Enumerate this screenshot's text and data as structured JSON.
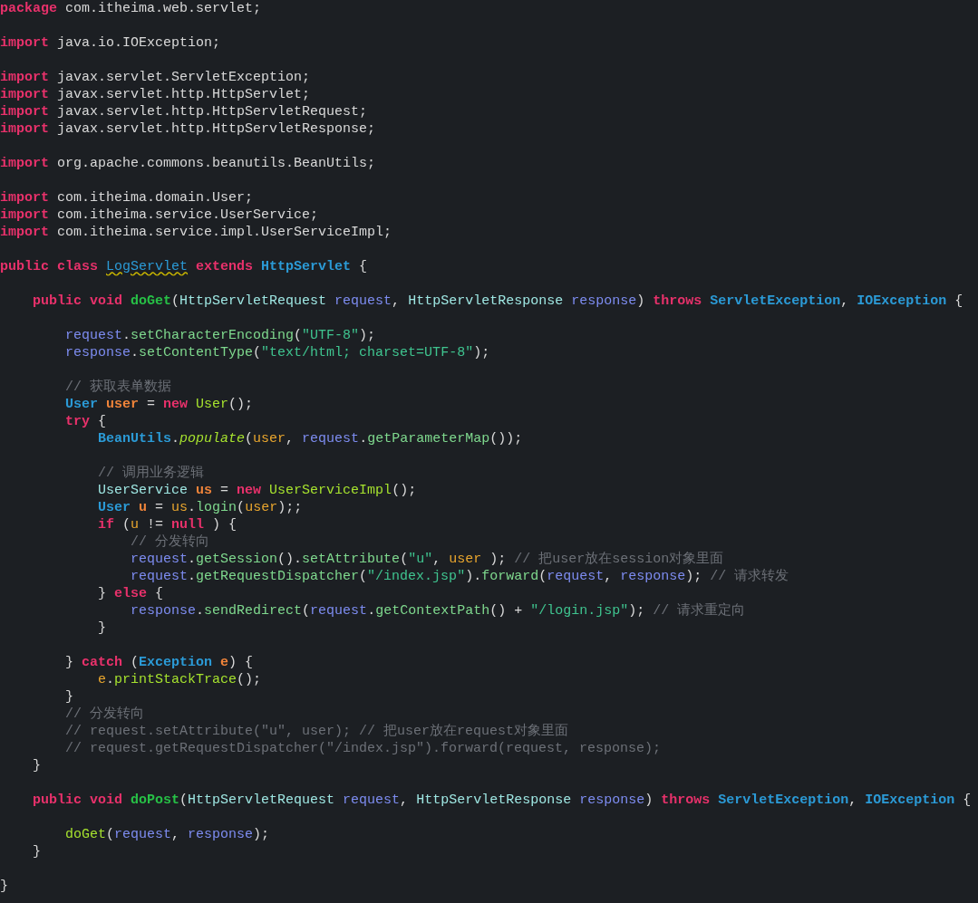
{
  "editor": {
    "blocks": [
      {
        "lines": [
          {
            "tokens": [
              {
                "kind": "kw",
                "text": "package"
              },
              {
                "kind": "plain",
                "text": " com.itheima.web.servlet;"
              }
            ]
          }
        ]
      },
      {
        "lines": [
          {
            "tokens": [
              {
                "kind": "kw",
                "text": "import"
              },
              {
                "kind": "plain",
                "text": " java.io.IOException;"
              }
            ]
          }
        ]
      },
      {
        "lines": [
          {
            "tokens": [
              {
                "kind": "kw",
                "text": "import"
              },
              {
                "kind": "plain",
                "text": " javax.servlet.ServletException;"
              }
            ]
          },
          {
            "tokens": [
              {
                "kind": "kw",
                "text": "import"
              },
              {
                "kind": "plain",
                "text": " javax.servlet.http.HttpServlet;"
              }
            ]
          },
          {
            "tokens": [
              {
                "kind": "kw",
                "text": "import"
              },
              {
                "kind": "plain",
                "text": " javax.servlet.http.HttpServletRequest;"
              }
            ]
          },
          {
            "tokens": [
              {
                "kind": "kw",
                "text": "import"
              },
              {
                "kind": "plain",
                "text": " javax.servlet.http.HttpServletResponse;"
              }
            ]
          }
        ]
      },
      {
        "lines": [
          {
            "tokens": [
              {
                "kind": "kw",
                "text": "import"
              },
              {
                "kind": "plain",
                "text": " org.apache.commons.beanutils.BeanUtils;"
              }
            ]
          }
        ]
      },
      {
        "lines": [
          {
            "tokens": [
              {
                "kind": "kw",
                "text": "import"
              },
              {
                "kind": "plain",
                "text": " com.itheima.domain.User;"
              }
            ]
          },
          {
            "tokens": [
              {
                "kind": "kw",
                "text": "import"
              },
              {
                "kind": "plain",
                "text": " com.itheima.service.UserService;"
              }
            ]
          },
          {
            "tokens": [
              {
                "kind": "kw",
                "text": "import"
              },
              {
                "kind": "plain",
                "text": " com.itheima.service.impl.UserServiceImpl;"
              }
            ]
          }
        ]
      },
      {
        "lines": [
          {
            "tokens": [
              {
                "kind": "kw",
                "text": "public class "
              },
              {
                "kind": "warn",
                "text": "LogServlet"
              },
              {
                "kind": "kw",
                "text": " extends "
              },
              {
                "kind": "type",
                "text": "HttpServlet"
              },
              {
                "kind": "plain",
                "text": " {"
              }
            ]
          }
        ]
      },
      {
        "lines": [
          {
            "tokens": [
              {
                "kind": "kw",
                "text": "    public void "
              },
              {
                "kind": "decl",
                "text": "doGet"
              },
              {
                "kind": "plain",
                "text": "("
              },
              {
                "kind": "cls",
                "text": "HttpServletRequest "
              },
              {
                "kind": "param",
                "text": "request"
              },
              {
                "kind": "plain",
                "text": ", "
              },
              {
                "kind": "cls",
                "text": "HttpServletResponse "
              },
              {
                "kind": "param",
                "text": "response"
              },
              {
                "kind": "plain",
                "text": ") "
              },
              {
                "kind": "kw",
                "text": "throws "
              },
              {
                "kind": "type",
                "text": "ServletException"
              },
              {
                "kind": "plain",
                "text": ", "
              },
              {
                "kind": "type",
                "text": "IOException"
              },
              {
                "kind": "plain",
                "text": " {"
              }
            ]
          }
        ]
      },
      {
        "lines": [
          {
            "tokens": [
              {
                "kind": "param",
                "text": "        request"
              },
              {
                "kind": "plain",
                "text": "."
              },
              {
                "kind": "fn",
                "text": "setCharacterEncoding"
              },
              {
                "kind": "plain",
                "text": "("
              },
              {
                "kind": "str",
                "text": "\"UTF-8\""
              },
              {
                "kind": "plain",
                "text": ");"
              }
            ]
          },
          {
            "tokens": [
              {
                "kind": "param",
                "text": "        response"
              },
              {
                "kind": "plain",
                "text": "."
              },
              {
                "kind": "fn",
                "text": "setContentType"
              },
              {
                "kind": "plain",
                "text": "("
              },
              {
                "kind": "str",
                "text": "\"text/html; charset=UTF-8\""
              },
              {
                "kind": "plain",
                "text": ");"
              }
            ]
          }
        ]
      },
      {
        "lines": [
          {
            "tokens": [
              {
                "kind": "cmt",
                "text": "        // 获取表单数据"
              }
            ]
          },
          {
            "tokens": [
              {
                "kind": "type",
                "text": "        User "
              },
              {
                "kind": "var",
                "text": "user"
              },
              {
                "kind": "plain",
                "text": " = "
              },
              {
                "kind": "kw",
                "text": "new "
              },
              {
                "kind": "call",
                "text": "User"
              },
              {
                "kind": "plain",
                "text": "();"
              }
            ]
          },
          {
            "tokens": [
              {
                "kind": "kw",
                "text": "        try"
              },
              {
                "kind": "plain",
                "text": " {"
              }
            ]
          },
          {
            "tokens": [
              {
                "kind": "type",
                "text": "            BeanUtils"
              },
              {
                "kind": "plain",
                "text": "."
              },
              {
                "kind": "italic",
                "text": "populate"
              },
              {
                "kind": "plain",
                "text": "("
              },
              {
                "kind": "ref",
                "text": "user"
              },
              {
                "kind": "plain",
                "text": ", "
              },
              {
                "kind": "param",
                "text": "request"
              },
              {
                "kind": "plain",
                "text": "."
              },
              {
                "kind": "fn",
                "text": "getParameterMap"
              },
              {
                "kind": "plain",
                "text": "());"
              }
            ]
          }
        ]
      },
      {
        "lines": [
          {
            "tokens": [
              {
                "kind": "cmt",
                "text": "            // 调用业务逻辑"
              }
            ]
          },
          {
            "tokens": [
              {
                "kind": "cls",
                "text": "            UserService "
              },
              {
                "kind": "var",
                "text": "us"
              },
              {
                "kind": "plain",
                "text": " = "
              },
              {
                "kind": "kw",
                "text": "new "
              },
              {
                "kind": "call",
                "text": "UserServiceImpl"
              },
              {
                "kind": "plain",
                "text": "();"
              }
            ]
          },
          {
            "tokens": [
              {
                "kind": "type",
                "text": "            User "
              },
              {
                "kind": "var",
                "text": "u"
              },
              {
                "kind": "plain",
                "text": " = "
              },
              {
                "kind": "ref",
                "text": "us"
              },
              {
                "kind": "plain",
                "text": "."
              },
              {
                "kind": "fn",
                "text": "login"
              },
              {
                "kind": "plain",
                "text": "("
              },
              {
                "kind": "ref",
                "text": "user"
              },
              {
                "kind": "plain",
                "text": ");;"
              }
            ]
          },
          {
            "tokens": [
              {
                "kind": "kw",
                "text": "            if"
              },
              {
                "kind": "plain",
                "text": " ("
              },
              {
                "kind": "ref",
                "text": "u"
              },
              {
                "kind": "plain",
                "text": " != "
              },
              {
                "kind": "kw",
                "text": "null"
              },
              {
                "kind": "plain",
                "text": " ) {"
              }
            ]
          },
          {
            "tokens": [
              {
                "kind": "cmt",
                "text": "                // 分发转向"
              }
            ]
          },
          {
            "tokens": [
              {
                "kind": "param",
                "text": "                request"
              },
              {
                "kind": "plain",
                "text": "."
              },
              {
                "kind": "fn",
                "text": "getSession"
              },
              {
                "kind": "plain",
                "text": "()."
              },
              {
                "kind": "fn",
                "text": "setAttribute"
              },
              {
                "kind": "plain",
                "text": "("
              },
              {
                "kind": "str",
                "text": "\"u\""
              },
              {
                "kind": "plain",
                "text": ", "
              },
              {
                "kind": "ref",
                "text": "user"
              },
              {
                "kind": "plain",
                "text": " ); "
              },
              {
                "kind": "cmt",
                "text": "// 把user放在session对象里面"
              }
            ]
          },
          {
            "tokens": [
              {
                "kind": "param",
                "text": "                request"
              },
              {
                "kind": "plain",
                "text": "."
              },
              {
                "kind": "fn",
                "text": "getRequestDispatcher"
              },
              {
                "kind": "plain",
                "text": "("
              },
              {
                "kind": "str",
                "text": "\"/index.jsp\""
              },
              {
                "kind": "plain",
                "text": ")."
              },
              {
                "kind": "fn",
                "text": "forward"
              },
              {
                "kind": "plain",
                "text": "("
              },
              {
                "kind": "param",
                "text": "request"
              },
              {
                "kind": "plain",
                "text": ", "
              },
              {
                "kind": "param",
                "text": "response"
              },
              {
                "kind": "plain",
                "text": "); "
              },
              {
                "kind": "cmt",
                "text": "// 请求转发"
              }
            ]
          },
          {
            "tokens": [
              {
                "kind": "plain",
                "text": "            } "
              },
              {
                "kind": "kw",
                "text": "else"
              },
              {
                "kind": "plain",
                "text": " {"
              }
            ]
          },
          {
            "tokens": [
              {
                "kind": "param",
                "text": "                response"
              },
              {
                "kind": "plain",
                "text": "."
              },
              {
                "kind": "fn",
                "text": "sendRedirect"
              },
              {
                "kind": "plain",
                "text": "("
              },
              {
                "kind": "param",
                "text": "request"
              },
              {
                "kind": "plain",
                "text": "."
              },
              {
                "kind": "fn",
                "text": "getContextPath"
              },
              {
                "kind": "plain",
                "text": "() + "
              },
              {
                "kind": "str",
                "text": "\"/login.jsp\""
              },
              {
                "kind": "plain",
                "text": "); "
              },
              {
                "kind": "cmt",
                "text": "// 请求重定向"
              }
            ]
          },
          {
            "tokens": [
              {
                "kind": "plain",
                "text": "            }"
              }
            ]
          }
        ]
      },
      {
        "lines": [
          {
            "tokens": [
              {
                "kind": "plain",
                "text": "        } "
              },
              {
                "kind": "kw",
                "text": "catch"
              },
              {
                "kind": "plain",
                "text": " ("
              },
              {
                "kind": "type",
                "text": "Exception "
              },
              {
                "kind": "var",
                "text": "e"
              },
              {
                "kind": "plain",
                "text": ") {"
              }
            ]
          },
          {
            "tokens": [
              {
                "kind": "ref",
                "text": "            e"
              },
              {
                "kind": "plain",
                "text": "."
              },
              {
                "kind": "call",
                "text": "printStackTrace"
              },
              {
                "kind": "plain",
                "text": "();"
              }
            ]
          },
          {
            "tokens": [
              {
                "kind": "plain",
                "text": "        }"
              }
            ]
          },
          {
            "tokens": [
              {
                "kind": "cmt",
                "text": "        // 分发转向"
              }
            ]
          },
          {
            "tokens": [
              {
                "kind": "cmt",
                "text": "        // request.setAttribute(\"u\", user); // 把user放在request对象里面"
              }
            ]
          },
          {
            "tokens": [
              {
                "kind": "cmt",
                "text": "        // request.getRequestDispatcher(\"/index.jsp\").forward(request, response);"
              }
            ]
          },
          {
            "tokens": [
              {
                "kind": "plain",
                "text": "    }"
              }
            ]
          }
        ]
      },
      {
        "lines": [
          {
            "tokens": [
              {
                "kind": "kw",
                "text": "    public void "
              },
              {
                "kind": "decl",
                "text": "doPost"
              },
              {
                "kind": "plain",
                "text": "("
              },
              {
                "kind": "cls",
                "text": "HttpServletRequest "
              },
              {
                "kind": "param",
                "text": "request"
              },
              {
                "kind": "plain",
                "text": ", "
              },
              {
                "kind": "cls",
                "text": "HttpServletResponse "
              },
              {
                "kind": "param",
                "text": "response"
              },
              {
                "kind": "plain",
                "text": ") "
              },
              {
                "kind": "kw",
                "text": "throws "
              },
              {
                "kind": "type",
                "text": "ServletException"
              },
              {
                "kind": "plain",
                "text": ", "
              },
              {
                "kind": "type",
                "text": "IOException"
              },
              {
                "kind": "plain",
                "text": " {"
              }
            ]
          }
        ]
      },
      {
        "lines": [
          {
            "tokens": [
              {
                "kind": "call",
                "text": "        doGet"
              },
              {
                "kind": "plain",
                "text": "("
              },
              {
                "kind": "param",
                "text": "request"
              },
              {
                "kind": "plain",
                "text": ", "
              },
              {
                "kind": "param",
                "text": "response"
              },
              {
                "kind": "plain",
                "text": ");"
              }
            ]
          },
          {
            "tokens": [
              {
                "kind": "plain",
                "text": "    }"
              }
            ]
          }
        ]
      },
      {
        "lines": [
          {
            "tokens": [
              {
                "kind": "plain",
                "text": "}"
              }
            ]
          }
        ]
      }
    ]
  }
}
